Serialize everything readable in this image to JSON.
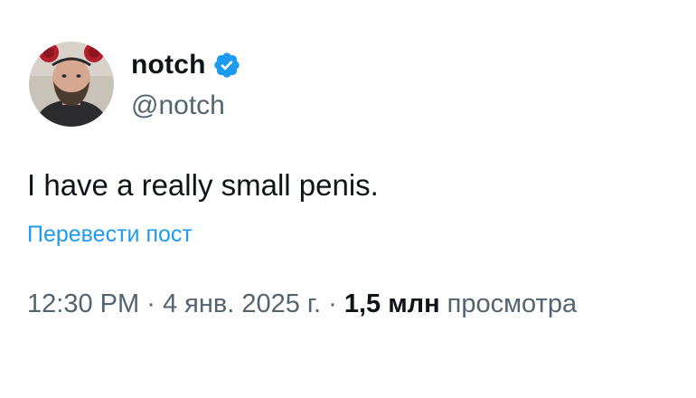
{
  "author": {
    "display_name": "notch",
    "handle": "@notch",
    "verified_icon": "verified-badge-icon",
    "avatar": "user-avatar-photo"
  },
  "tweet": {
    "text": "I have a really small penis.",
    "translate_label": "Перевести пост"
  },
  "meta": {
    "time": "12:30 PM",
    "separator": "·",
    "date": "4 янв. 2025 г.",
    "views_count": "1,5 млн",
    "views_label": "просмотра"
  },
  "colors": {
    "text_primary": "#0f1419",
    "text_secondary": "#536471",
    "accent": "#1d9bf0",
    "background": "#ffffff"
  }
}
